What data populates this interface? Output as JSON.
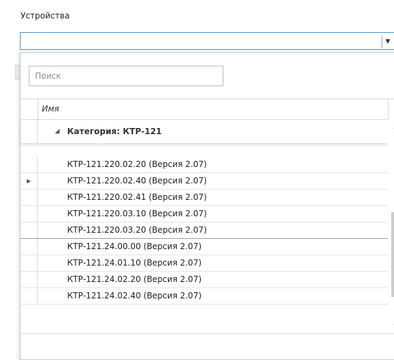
{
  "field": {
    "label": "Устройства",
    "value": ""
  },
  "icons": {
    "combo_arrow": "chevron-down-icon",
    "expand": "triangle-expanded-icon",
    "row_indicator": "triangle-right-icon"
  },
  "search": {
    "placeholder": "Поиск",
    "value": ""
  },
  "grid": {
    "column_header": "Имя",
    "category": "Категория: КТР-121",
    "rows": [
      "КТР-121.220.02.20 (Версия 2.07)",
      "КТР-121.220.02.40 (Версия 2.07)",
      "КТР-121.220.02.41 (Версия 2.07)",
      "КТР-121.220.03.10 (Версия 2.07)",
      "КТР-121.220.03.20 (Версия 2.07)",
      "КТР-121.24.00.00 (Версия 2.07)",
      "КТР-121.24.01.10 (Версия 2.07)",
      "КТР-121.24.02.20 (Версия 2.07)",
      "КТР-121.24.02.40 (Версия 2.07)"
    ],
    "current_row_index": 1
  }
}
